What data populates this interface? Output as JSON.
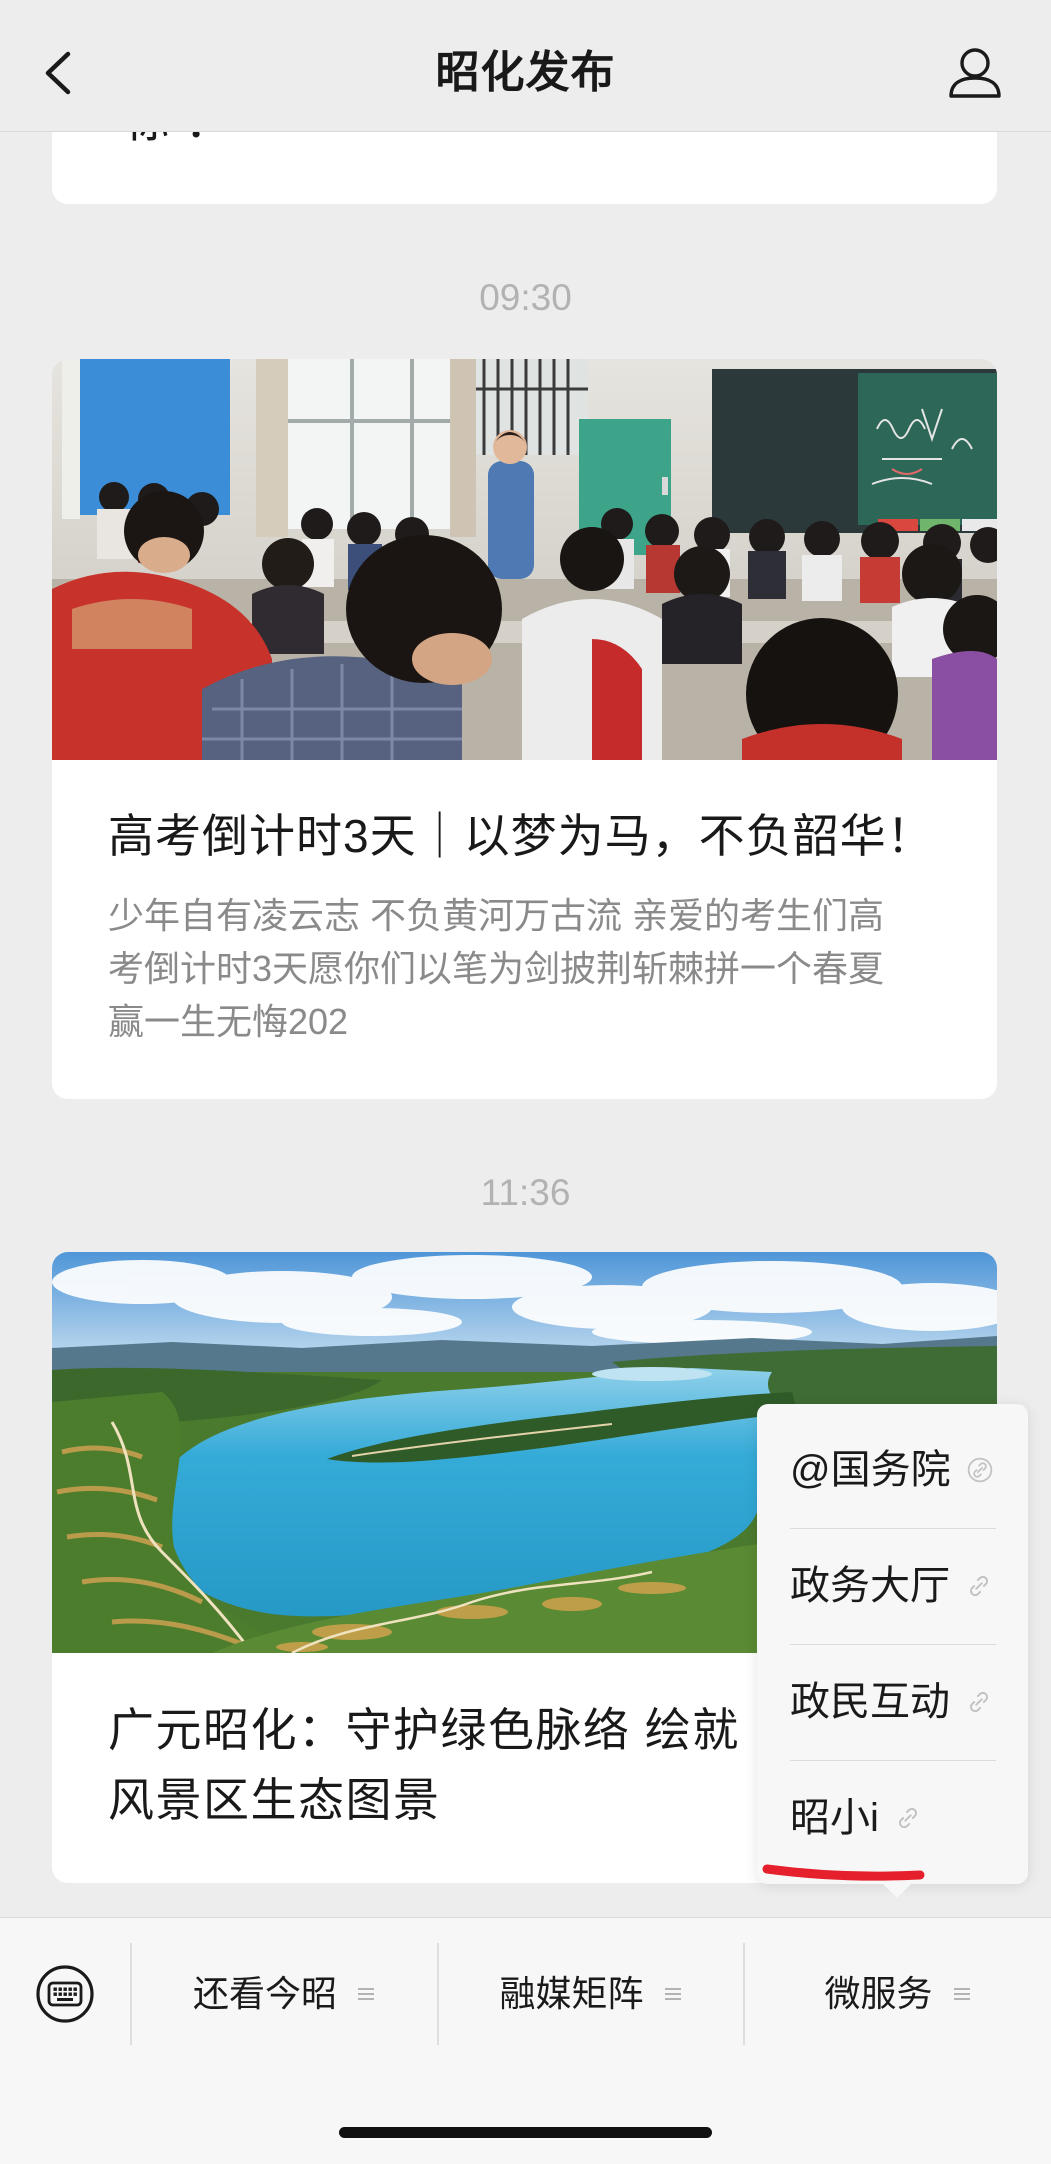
{
  "nav": {
    "title": "昭化发布",
    "back_icon": "chevron-left-icon",
    "profile_icon": "person-icon"
  },
  "feed": {
    "previous_card": {
      "title_fragment": "“标”："
    },
    "messages": [
      {
        "time": "09:30",
        "cover_image": "classroom-photo",
        "title": "高考倒计时3天｜以梦为马，不负韶华！",
        "summary_lines": [
          "少年自有凌云志  不负黄河万古流 亲爱的考生们高",
          "考倒计时3天愿你们以笔为剑披荆斩棘拼一个春夏",
          "赢一生无悔202"
        ]
      },
      {
        "time": "11:36",
        "cover_image": "lake-landscape-photo",
        "title_lines": [
          "广元昭化：守护绿色脉络  绘就",
          "风景区生态图景"
        ]
      }
    ]
  },
  "submenu": {
    "items": [
      {
        "label": "@国务院",
        "icon": "mini-program-icon"
      },
      {
        "label": "政务大厅",
        "icon": "link-icon"
      },
      {
        "label": "政民互动",
        "icon": "link-icon"
      },
      {
        "label": "昭小i",
        "icon": "link-icon"
      }
    ]
  },
  "bottom_menu": {
    "keyboard_icon": "keyboard-icon",
    "items": [
      {
        "label": "还看今昭",
        "icon": "menu-lines-icon"
      },
      {
        "label": "融媒矩阵",
        "icon": "menu-lines-icon"
      },
      {
        "label": "微服务",
        "icon": "menu-lines-icon"
      }
    ]
  },
  "colors": {
    "page_bg": "#ededed",
    "card_bg": "#ffffff",
    "popup_bg": "#f7f7f7",
    "bar_bg": "#f7f7f7",
    "timestamp": "#b2b2b2",
    "summary_text": "#8a8a8a",
    "annotation_red": "#e5202c"
  }
}
